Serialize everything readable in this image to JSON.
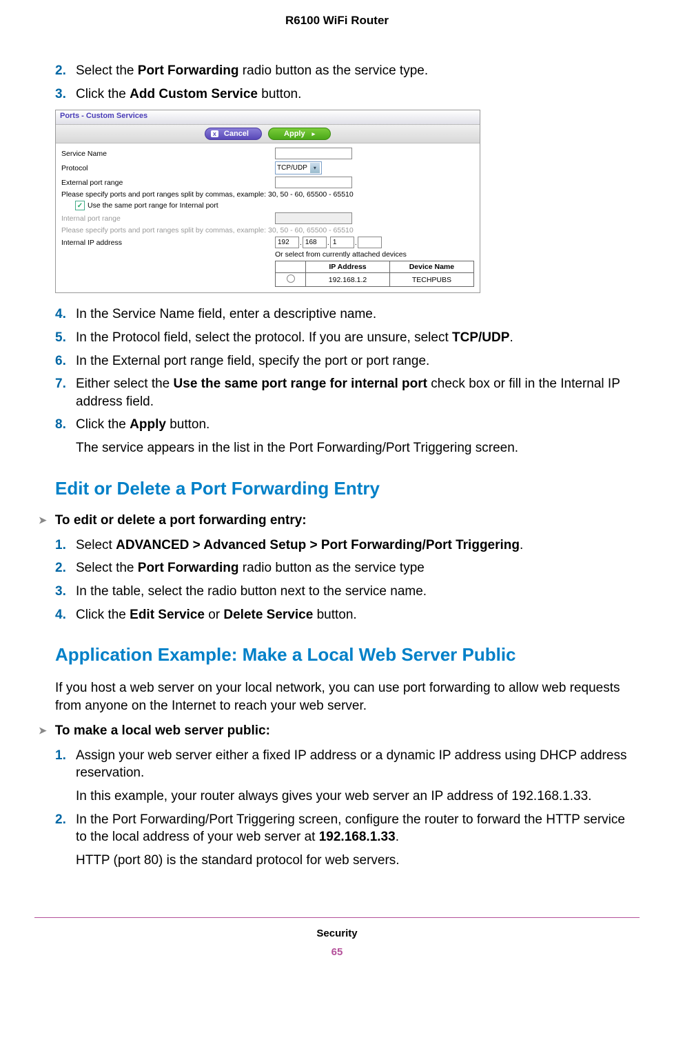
{
  "header": {
    "title": "R6100 WiFi Router"
  },
  "steps_a": [
    {
      "num": "2.",
      "parts": [
        "Select the ",
        "Port Forwarding",
        " radio button as the service type."
      ]
    },
    {
      "num": "3.",
      "parts": [
        "Click the ",
        "Add Custom Service",
        " button."
      ]
    }
  ],
  "screenshot": {
    "title": "Ports - Custom Services",
    "cancel_label": "Cancel",
    "apply_label": "Apply",
    "service_name_label": "Service Name",
    "protocol_label": "Protocol",
    "protocol_value": "TCP/UDP",
    "external_port_label": "External port range",
    "port_note": "Please specify ports and port ranges split by commas, example: 30, 50 - 60, 65500 - 65510",
    "checkbox_label": "Use the same port range for Internal port",
    "internal_port_label": "Internal port range",
    "internal_ip_label": "Internal IP address",
    "ip_octet1": "192",
    "ip_octet2": "168",
    "ip_octet3": "1",
    "or_select_label": "Or select from currently attached devices",
    "table_headers": {
      "ip": "IP Address",
      "device": "Device Name"
    },
    "table_row": {
      "ip": "192.168.1.2",
      "device": "TECHPUBS"
    }
  },
  "steps_b": [
    {
      "num": "4.",
      "text": "In the Service Name field, enter a descriptive name."
    },
    {
      "num": "5.",
      "parts": [
        "In the Protocol field, select the protocol. If you are unsure, select ",
        "TCP/UDP",
        "."
      ]
    },
    {
      "num": "6.",
      "text": "In the External port range field, specify the port or port range."
    },
    {
      "num": "7.",
      "parts": [
        "Either select the ",
        "Use the same port range for internal port",
        " check box or fill in the Internal IP address field."
      ]
    },
    {
      "num": "8.",
      "parts": [
        "Click the ",
        "Apply",
        " button."
      ],
      "extra": "The service appears in the list in the Port Forwarding/Port Triggering screen."
    }
  ],
  "heading1": "Edit or Delete a Port Forwarding Entry",
  "sub1": "To edit or delete a port forwarding entry:",
  "steps_c": [
    {
      "num": "1.",
      "parts": [
        "Select ",
        "ADVANCED > Advanced Setup > Port Forwarding/Port Triggering",
        "."
      ]
    },
    {
      "num": "2.",
      "parts": [
        "Select the ",
        "Port Forwarding",
        " radio button as the service type"
      ]
    },
    {
      "num": "3.",
      "text": "In the table, select the radio button next to the service name."
    },
    {
      "num": "4.",
      "parts": [
        "Click the ",
        "Edit Service",
        " or ",
        "Delete Service",
        " button."
      ]
    }
  ],
  "heading2": "Application Example: Make a Local Web Server Public",
  "para1": "If you host a web server on your local network, you can use port forwarding to allow web requests from anyone on the Internet to reach your web server.",
  "sub2": "To make a local web server public:",
  "steps_d": [
    {
      "num": "1.",
      "text": "Assign your web server either a fixed IP address or a dynamic IP address using DHCP address reservation.",
      "extra": "In this example, your router always gives your web server an IP address of 192.168.1.33."
    },
    {
      "num": "2.",
      "parts": [
        "In the Port Forwarding/Port Triggering screen, configure the router to forward the HTTP service to the local address of your web server at ",
        "192.168.1.33",
        "."
      ],
      "extra": "HTTP (port 80) is the standard protocol for web servers."
    }
  ],
  "footer": {
    "label": "Security",
    "page": "65"
  }
}
